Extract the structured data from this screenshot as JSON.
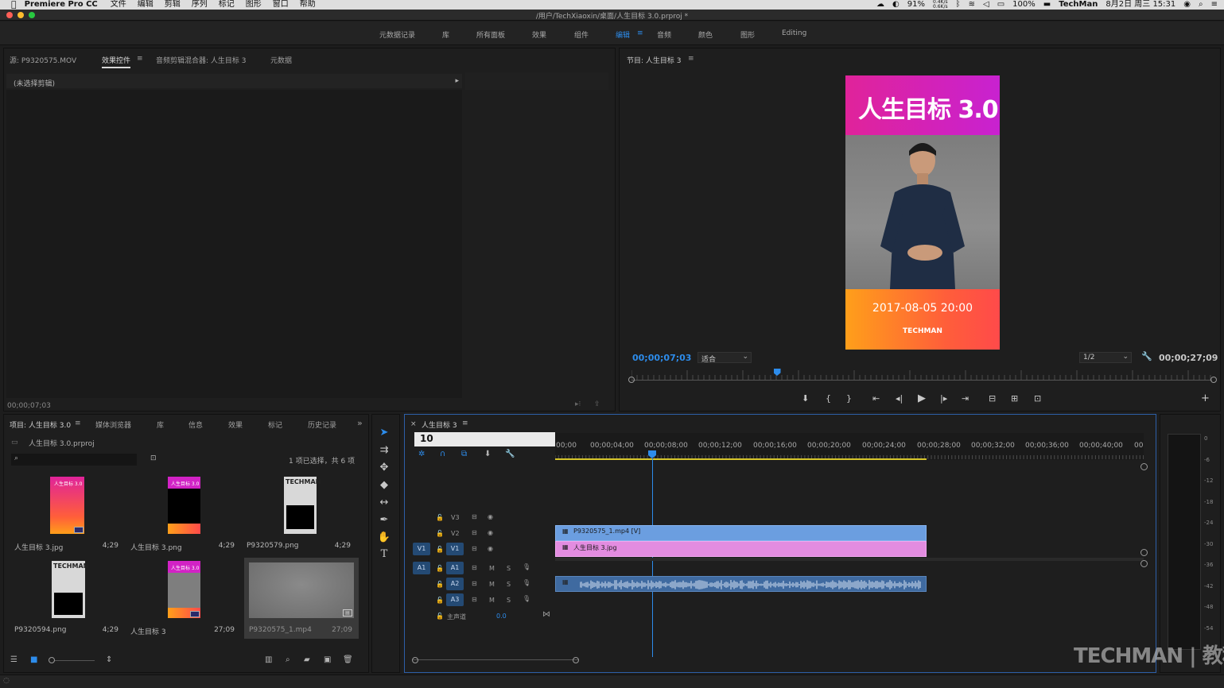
{
  "menubar": {
    "app": "Premiere Pro CC",
    "items": [
      "文件",
      "编辑",
      "剪辑",
      "序列",
      "标记",
      "图形",
      "窗口",
      "帮助"
    ],
    "battery": "91%",
    "net_up": "0.4K/s",
    "net_down": "0.6K/s",
    "volume_pct": "100%",
    "user": "TechMan",
    "datetime": "8月2日 周三  15:31"
  },
  "window": {
    "title": "/用户/TechXiaoxin/桌面/人生目标 3.0.prproj *"
  },
  "workspaces": [
    "元数据记录",
    "库",
    "所有面板",
    "效果",
    "组件",
    "编辑",
    "音频",
    "颜色",
    "图形",
    "Editing"
  ],
  "workspace_active": "编辑",
  "source_panel": {
    "tabs": [
      "源: P9320575.MOV",
      "效果控件",
      "音频剪辑混合器: 人生目标 3",
      "元数据"
    ],
    "active_tab": "效果控件",
    "no_clip": "(未选择剪辑)",
    "timecode": "00;00;07;03"
  },
  "program_panel": {
    "title": "节目: 人生目标 3",
    "timecode": "00;00;07;03",
    "fit": "适合",
    "resolution": "1/2",
    "duration": "00;00;27;09",
    "playhead_fraction": 0.25,
    "poster": {
      "title": "人生目标 3.0",
      "date": "2017-08-05 20:00",
      "brand": "TECHMAN"
    }
  },
  "project_panel": {
    "tabs": [
      "项目: 人生目标 3.0",
      "媒体浏览器",
      "库",
      "信息",
      "效果",
      "标记",
      "历史记录"
    ],
    "active_tab": "项目: 人生目标 3.0",
    "file": "人生目标 3.0.prproj",
    "selection_info": "1 项已选择，共 6 项",
    "items": [
      {
        "name": "人生目标 3.jpg",
        "duration": "4;29",
        "kind": "poster"
      },
      {
        "name": "人生目标 3.png",
        "duration": "4;29",
        "kind": "poster-dark"
      },
      {
        "name": "P9320579.png",
        "duration": "4;29",
        "kind": "techman"
      },
      {
        "name": "P9320594.png",
        "duration": "4;29",
        "kind": "techman"
      },
      {
        "name": "人生目标 3",
        "duration": "27;09",
        "kind": "sequence"
      },
      {
        "name": "P9320575_1.mp4",
        "duration": "27;09",
        "kind": "video"
      }
    ],
    "thumb_labels": {
      "poster_mini": "人生目标 3.0",
      "techman": "TECHMAN"
    }
  },
  "timeline": {
    "sequence": "人生目标 3",
    "timecode": "10",
    "ruler": [
      "00;00",
      "00;00;04;00",
      "00;00;08;00",
      "00;00;12;00",
      "00;00;16;00",
      "00;00;20;00",
      "00;00;24;00",
      "00;00;28;00",
      "00;00;32;00",
      "00;00;36;00",
      "00;00;40;00",
      "00"
    ],
    "tracks": {
      "video": [
        "V3",
        "V2",
        "V1"
      ],
      "audio": [
        "A1",
        "A2",
        "A3"
      ],
      "src_v": "V1",
      "src_a": "A1",
      "master": "主声道",
      "master_value": "0.0",
      "mute": "M",
      "solo": "S"
    },
    "clips": {
      "v2": "P9320575_1.mp4 [V]",
      "v1": "人生目标 3.jpg"
    }
  },
  "meter_scale": [
    "0",
    "-6",
    "-12",
    "-18",
    "-24",
    "-30",
    "-36",
    "-42",
    "-48",
    "-54"
  ],
  "watermark": "TECHMAN | 教程",
  "colors": {
    "accent": "#2d8ceb",
    "clip_video": "#6b9ee0",
    "clip_image": "#e38ce0",
    "clip_audio": "#3f6aa0"
  }
}
